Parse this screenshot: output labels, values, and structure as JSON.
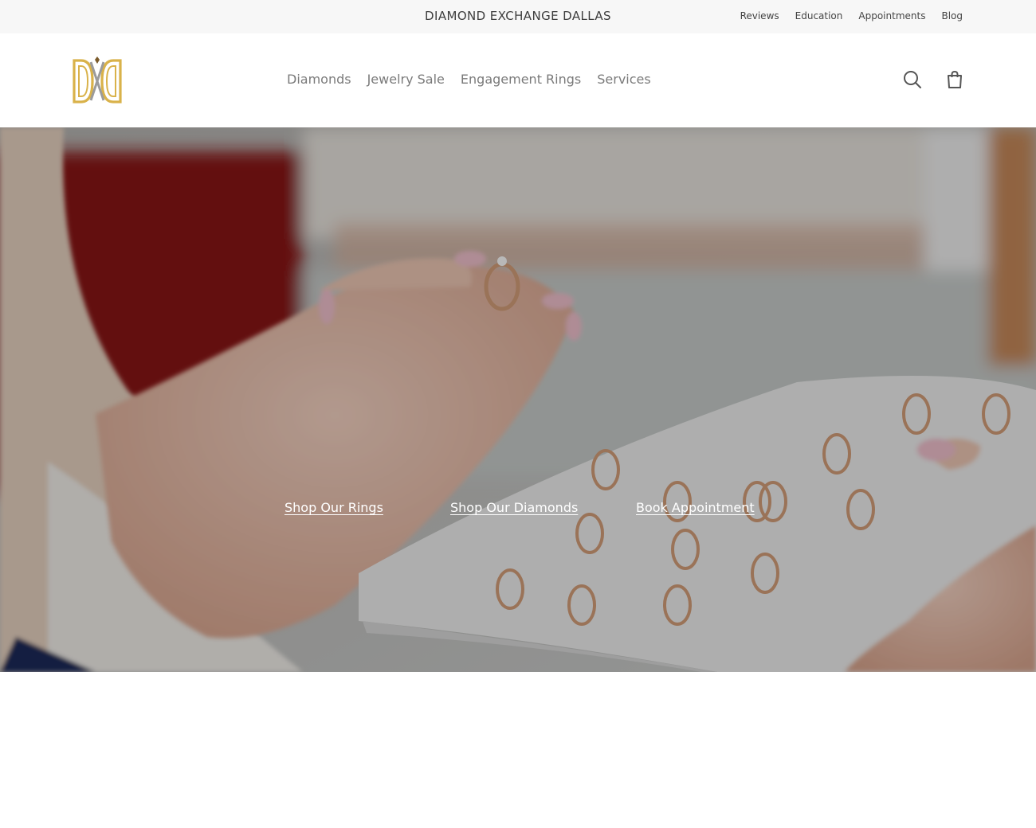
{
  "topbar": {
    "title": "DIAMOND EXCHANGE DALLAS",
    "links": [
      "Reviews",
      "Education",
      "Appointments",
      "Blog"
    ]
  },
  "header": {
    "logo_text": "DXD",
    "nav": [
      "Diamonds",
      "Jewelry Sale",
      "Engagement Rings",
      "Services"
    ],
    "icons": [
      "search-icon",
      "shopping-bag-icon"
    ]
  },
  "hero": {
    "links": [
      "Shop Our Rings",
      "Shop Our Diamonds",
      "Book Appointment"
    ]
  },
  "colors": {
    "topbar_bg": "#f7f7f7",
    "nav_text": "#7a7a7a",
    "logo_gold": "#d9b24a",
    "hero_link": "#ffffff"
  }
}
